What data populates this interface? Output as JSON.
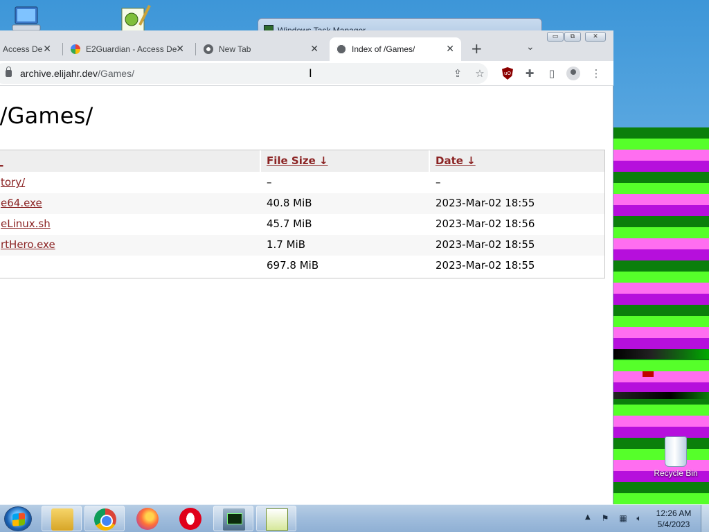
{
  "desktop": {
    "recycle_bin_label": "Recycle Bin",
    "background_window_title": "Windows Task Manager"
  },
  "browser": {
    "tabs": [
      {
        "label": "Access De",
        "favicon": "globe-icon",
        "active": false
      },
      {
        "label": "E2Guardian - Access De",
        "favicon": "google-icon",
        "active": false
      },
      {
        "label": "New Tab",
        "favicon": "chrome-icon",
        "active": false
      },
      {
        "label": "Index of /Games/",
        "favicon": "globe-icon",
        "active": true
      }
    ],
    "new_tab_symbol": "+",
    "tab_search_symbol": "⌄",
    "close_symbol": "✕",
    "url_host": "archive.elijahr.dev",
    "url_path": "/Games/",
    "window_controls": {
      "minimize": "▭",
      "maximize": "⧉",
      "close": "✕"
    }
  },
  "page": {
    "title": "of /Games/",
    "columns": {
      "name": "_",
      "size": "File Size  ↓",
      "date": "Date  ↓"
    },
    "rows": [
      {
        "name": "tory/",
        "size": "–",
        "date": "–"
      },
      {
        "name": "e64.exe",
        "size": "40.8 MiB",
        "date": "2023-Mar-02 18:55"
      },
      {
        "name": "eLinux.sh",
        "size": "45.7 MiB",
        "date": "2023-Mar-02 18:56"
      },
      {
        "name": "rtHero.exe",
        "size": "1.7 MiB",
        "date": "2023-Mar-02 18:55"
      },
      {
        "name": "",
        "size": "697.8 MiB",
        "date": "2023-Mar-02 18:55"
      }
    ]
  },
  "taskbar": {
    "apps": [
      "start-button",
      "file-explorer",
      "chrome",
      "firefox",
      "opera",
      "task-manager",
      "notepad"
    ],
    "tray_show_hidden": "▲",
    "clock_time": "12:26 AM",
    "clock_date": "5/4/2023"
  },
  "colors": {
    "link": "#8b2323",
    "stripe_green_dark": "#0b7f0b",
    "stripe_green_light": "#56ff2a",
    "stripe_pink": "#ff6ef0",
    "stripe_purple": "#b60fdc"
  }
}
